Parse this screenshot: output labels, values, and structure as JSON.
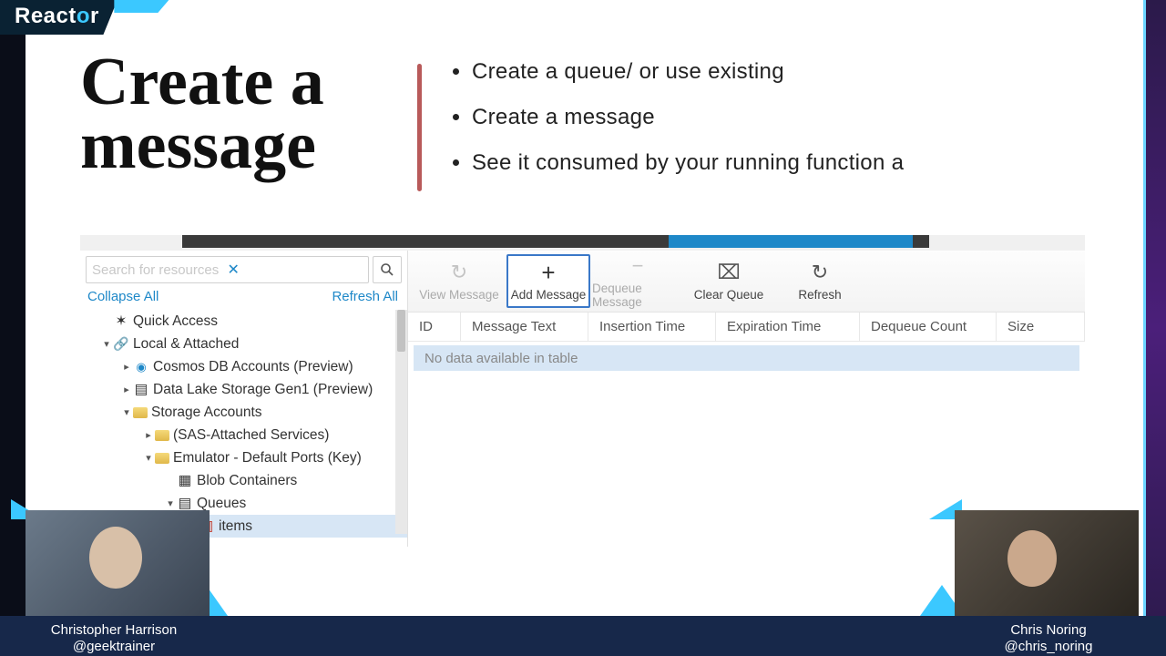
{
  "brand": {
    "name_pre": "React",
    "name_o": "o",
    "name_post": "r"
  },
  "slide": {
    "title_line1": "Create a",
    "title_line2": "message",
    "bullets": [
      "Create a queue/ or use existing",
      "Create a message",
      "See it consumed by your running function a"
    ]
  },
  "explorer": {
    "search_placeholder": "Search for resources",
    "collapse": "Collapse All",
    "refresh": "Refresh All",
    "tree": {
      "quick_access": "Quick Access",
      "local_attached": "Local & Attached",
      "cosmos": "Cosmos DB Accounts (Preview)",
      "datalake": "Data Lake Storage Gen1 (Preview)",
      "storage_accounts": "Storage Accounts",
      "sas": "(SAS-Attached Services)",
      "emulator": "Emulator - Default Ports (Key)",
      "blobs": "Blob Containers",
      "queues": "Queues",
      "items": "items"
    },
    "toolbar": {
      "view": "View Message",
      "add": "Add Message",
      "dequeue": "Dequeue Message",
      "clear": "Clear Queue",
      "refresh": "Refresh"
    },
    "columns": {
      "id": "ID",
      "text": "Message Text",
      "insertion": "Insertion Time",
      "expiration": "Expiration Time",
      "dequeue": "Dequeue Count",
      "size": "Size"
    },
    "empty": "No data available in table"
  },
  "presenters": {
    "left": {
      "name": "Christopher Harrison",
      "handle": "@geektrainer"
    },
    "right": {
      "name": "Chris Noring",
      "handle": "@chris_noring"
    }
  }
}
